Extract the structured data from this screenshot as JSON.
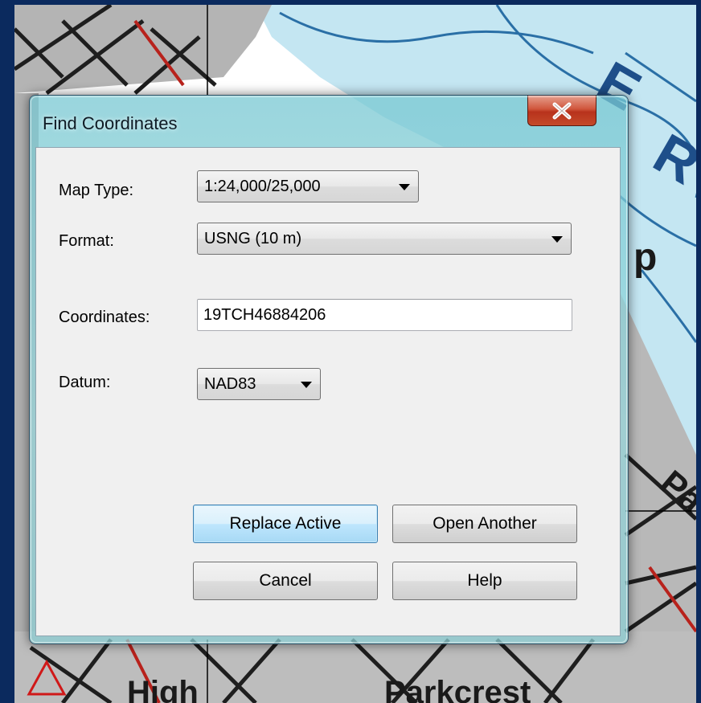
{
  "dialog": {
    "title": "Find Coordinates",
    "close_icon": "close-x-icon"
  },
  "form": {
    "map_type_label": "Map Type:",
    "map_type_value": "1:24,000/25,000",
    "format_label": "Format:",
    "format_value": "USNG (10 m)",
    "coordinates_label": "Coordinates:",
    "coordinates_value": "19TCH46884206",
    "datum_label": "Datum:",
    "datum_value": "NAD83"
  },
  "buttons": {
    "replace_active": "Replace Active",
    "open_another": "Open Another",
    "cancel": "Cancel",
    "help": "Help"
  },
  "colors": {
    "window_frame": "#0b2a5e",
    "close_button": "#c7472a",
    "default_button_border": "#3c7fb1"
  }
}
